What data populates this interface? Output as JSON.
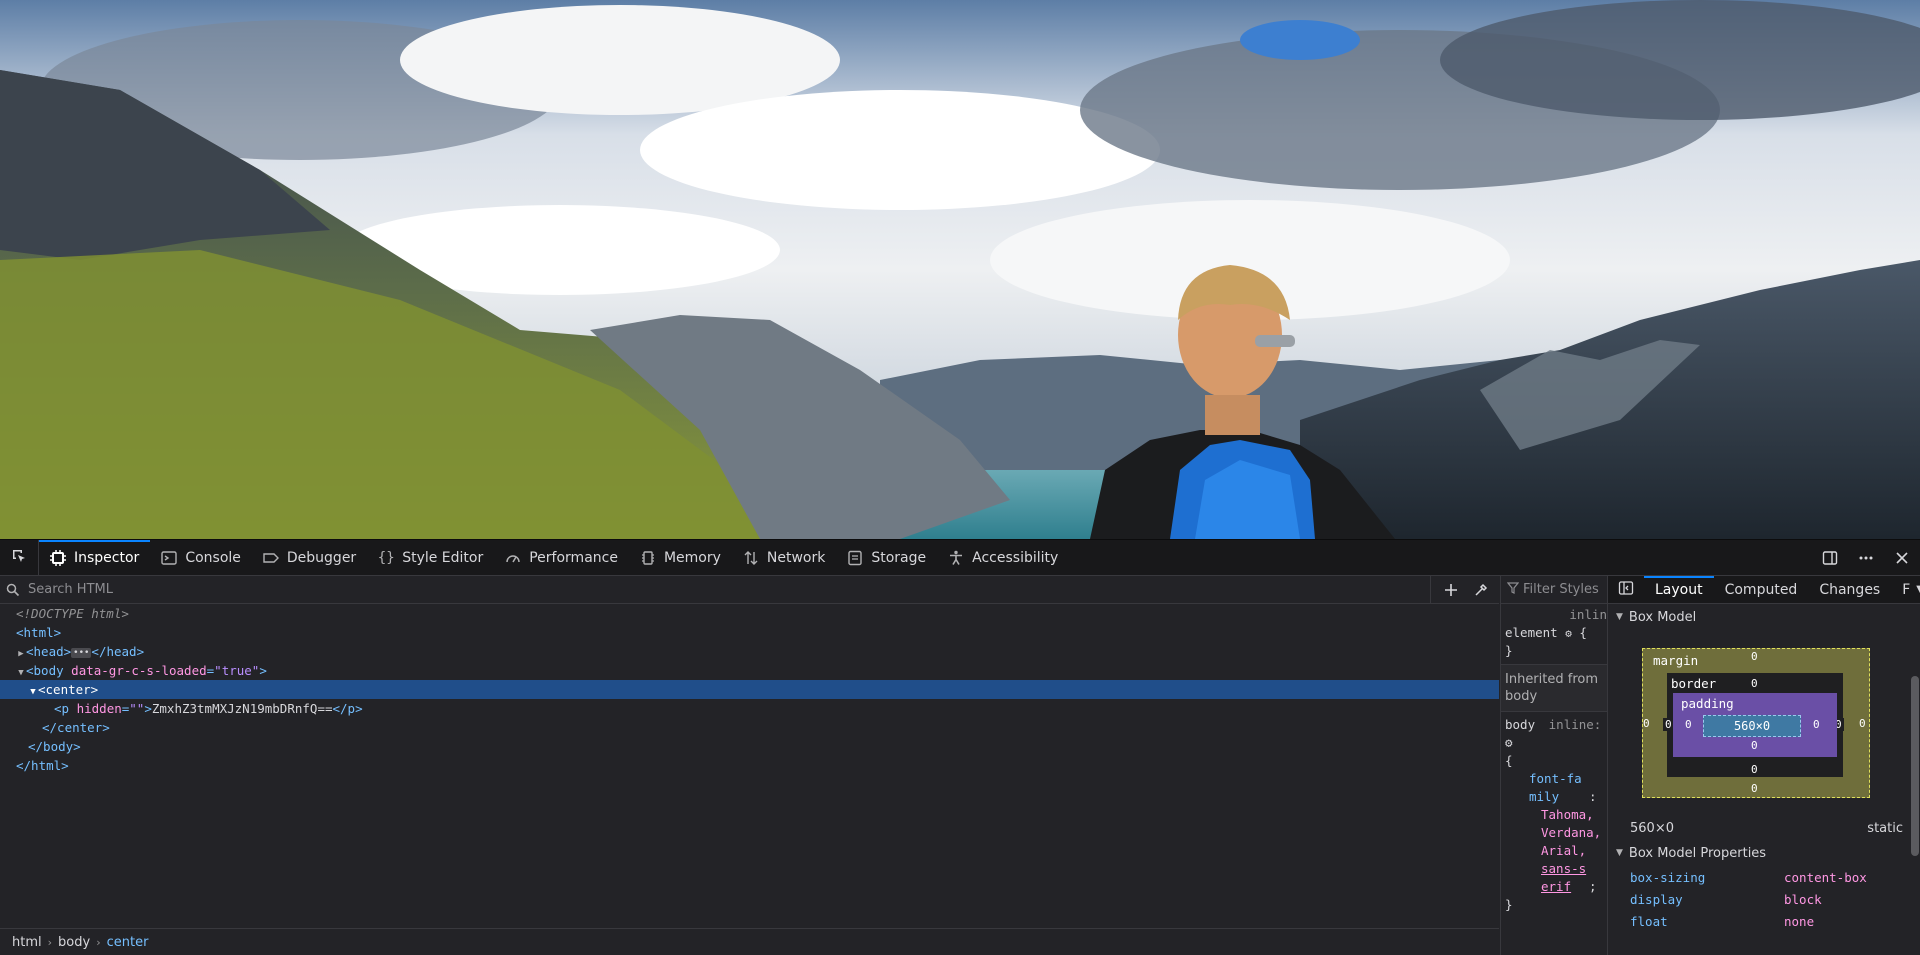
{
  "toolbar": {
    "tabs": [
      {
        "label": "Inspector",
        "icon": "inspector-icon"
      },
      {
        "label": "Console",
        "icon": "console-icon"
      },
      {
        "label": "Debugger",
        "icon": "debugger-icon"
      },
      {
        "label": "Style Editor",
        "icon": "braces-icon"
      },
      {
        "label": "Performance",
        "icon": "gauge-icon"
      },
      {
        "label": "Memory",
        "icon": "memory-icon"
      },
      {
        "label": "Network",
        "icon": "network-arrows-icon"
      },
      {
        "label": "Storage",
        "icon": "storage-icon"
      },
      {
        "label": "Accessibility",
        "icon": "accessibility-icon"
      }
    ],
    "selected_tab": "Inspector"
  },
  "markup": {
    "search_placeholder": "Search HTML",
    "tree": {
      "doctype": "<!DOCTYPE html>",
      "html_open": "<html>",
      "head_open": "<head>",
      "head_close": "</head>",
      "body_open_tag": "<body",
      "body_attr_name": "data-gr-c-s-loaded",
      "body_attr_value": "\"true\"",
      "center_open": "<center>",
      "p_open_tag": "<p",
      "p_attr_name": "hidden",
      "p_attr_value": "\"\"",
      "p_text": "ZmxhZ3tmMXJzN19mbDRnfQ==",
      "p_close": "</p>",
      "center_close": "</center>",
      "body_close": "</body>",
      "html_close": "</html>"
    },
    "breadcrumbs": [
      "html",
      "body",
      "center"
    ]
  },
  "rules": {
    "filter_placeholder": "Filter Styles",
    "inline_label": "inlin",
    "element_selector": "element",
    "open_brace": "{",
    "close_brace": "}",
    "inherited_label": "Inherited from body",
    "body_selector": "body",
    "body_source": "inline:",
    "font_family_prop": "font-family",
    "font_family_values": [
      "Tahoma,",
      "Verdana,",
      "Arial,",
      "sans-serif"
    ]
  },
  "sidebar": {
    "tabs": [
      "Layout",
      "Computed",
      "Changes",
      "F"
    ],
    "selected_tab": "Layout",
    "box_model_title": "Box Model",
    "box_model": {
      "margin_label": "margin",
      "border_label": "border",
      "padding_label": "padding",
      "content_size": "560×0",
      "margin": {
        "top": "0",
        "right": "0",
        "bottom": "0",
        "left": "0"
      },
      "border": {
        "top": "0",
        "right": "0",
        "bottom": "0",
        "left": "0"
      },
      "padding": {
        "top": "0",
        "right": "0",
        "bottom": "0",
        "left": "0"
      }
    },
    "dimensions": "560×0",
    "position": "static",
    "properties_title": "Box Model Properties",
    "properties": [
      {
        "name": "box-sizing",
        "value": "content-box"
      },
      {
        "name": "display",
        "value": "block"
      },
      {
        "name": "float",
        "value": "none"
      }
    ]
  }
}
